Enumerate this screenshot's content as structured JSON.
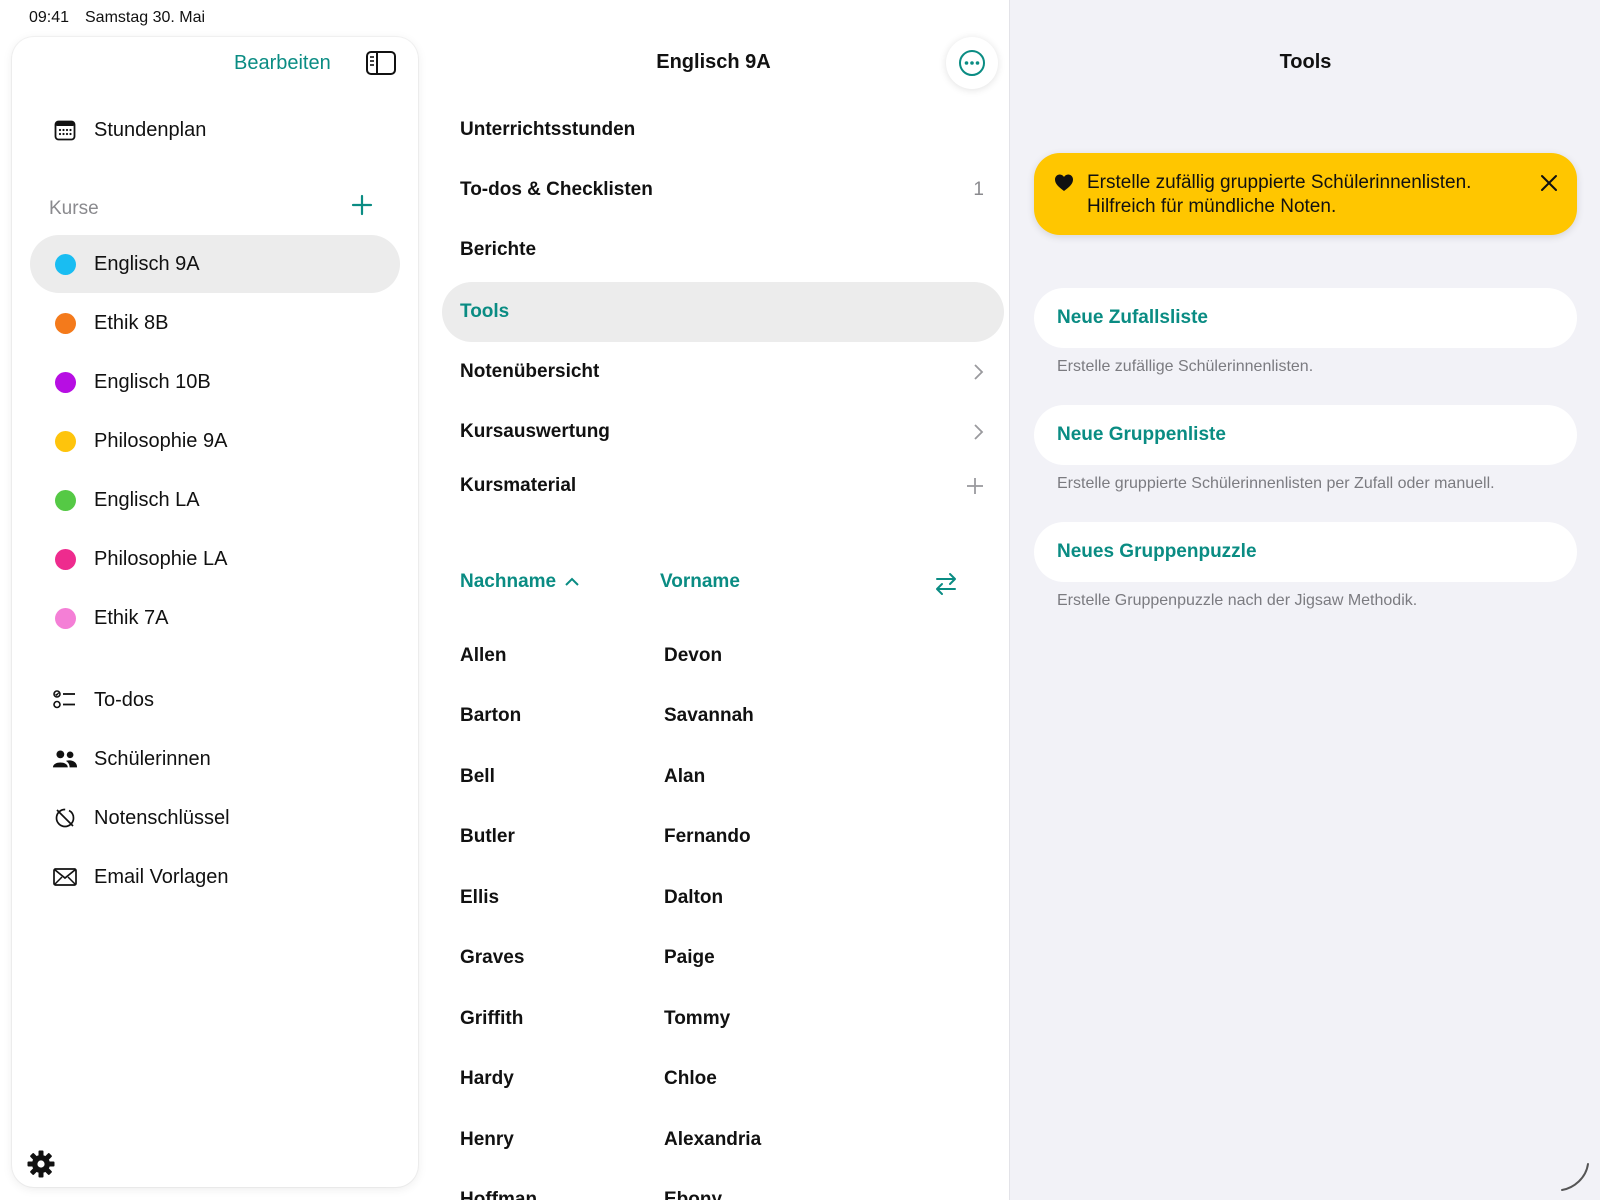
{
  "status_bar": {
    "time": "09:41",
    "date": "Samstag 30. Mai"
  },
  "sidebar": {
    "edit_label": "Bearbeiten",
    "schedule_label": "Stundenplan",
    "courses_header": "Kurse",
    "courses": [
      {
        "label": "Englisch 9A",
        "color": "#19bdf2",
        "active": true
      },
      {
        "label": "Ethik 8B",
        "color": "#f47a1b",
        "active": false
      },
      {
        "label": "Englisch 10B",
        "color": "#b70ee3",
        "active": false
      },
      {
        "label": "Philosophie 9A",
        "color": "#fec40c",
        "active": false
      },
      {
        "label": "Englisch LA",
        "color": "#55c945",
        "active": false
      },
      {
        "label": "Philosophie LA",
        "color": "#ee2b8e",
        "active": false
      },
      {
        "label": "Ethik 7A",
        "color": "#f47fd6",
        "active": false
      }
    ],
    "nav": [
      {
        "label": "To-dos",
        "icon": "checklist-icon"
      },
      {
        "label": "Schülerinnen",
        "icon": "people-icon"
      },
      {
        "label": "Notenschlüssel",
        "icon": "grade-key-icon"
      },
      {
        "label": "Email Vorlagen",
        "icon": "envelope-icon"
      }
    ]
  },
  "middle": {
    "title": "Englisch 9A",
    "menu": [
      {
        "label": "Unterrichtsstunden",
        "accessory": ""
      },
      {
        "label": "To-dos & Checklisten",
        "accessory": "1"
      },
      {
        "label": "Berichte",
        "accessory": ""
      },
      {
        "label": "Tools",
        "accessory": ""
      },
      {
        "label": "Notenübersicht",
        "accessory": "chevron"
      },
      {
        "label": "Kursauswertung",
        "accessory": "chevron"
      },
      {
        "label": "Kursmaterial",
        "accessory": "plus"
      }
    ],
    "columns": {
      "last_name": "Nachname",
      "first_name": "Vorname"
    },
    "students": [
      {
        "last": "Allen",
        "first": "Devon"
      },
      {
        "last": "Barton",
        "first": "Savannah"
      },
      {
        "last": "Bell",
        "first": "Alan"
      },
      {
        "last": "Butler",
        "first": "Fernando"
      },
      {
        "last": "Ellis",
        "first": "Dalton"
      },
      {
        "last": "Graves",
        "first": "Paige"
      },
      {
        "last": "Griffith",
        "first": "Tommy"
      },
      {
        "last": "Hardy",
        "first": "Chloe"
      },
      {
        "last": "Henry",
        "first": "Alexandria"
      },
      {
        "last": "Hoffman",
        "first": "Ebony"
      }
    ]
  },
  "right": {
    "title": "Tools",
    "banner": {
      "line1": "Erstelle zufällig gruppierte Schülerinnenlisten.",
      "line2": "Hilfreich für mündliche Noten."
    },
    "tools": [
      {
        "label": "Neue Zufallsliste",
        "description": "Erstelle zufällige Schülerinnenlisten."
      },
      {
        "label": "Neue Gruppenliste",
        "description": "Erstelle gruppierte Schülerinnenlisten per Zufall oder manuell."
      },
      {
        "label": "Neues Gruppenpuzzle",
        "description": "Erstelle Gruppenpuzzle nach der Jigsaw Methodik."
      }
    ]
  },
  "colors": {
    "accent": "#0a8c83",
    "banner": "#ffc600"
  }
}
